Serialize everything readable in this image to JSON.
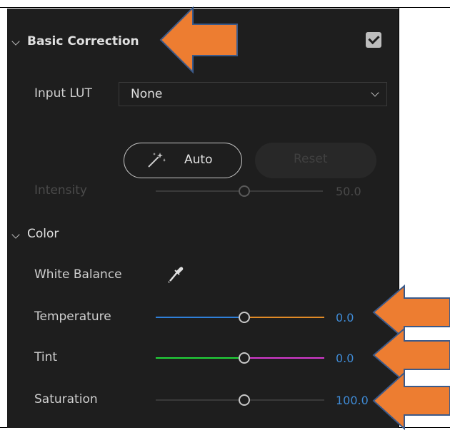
{
  "section_basic": {
    "title": "Basic Correction",
    "enabled": true
  },
  "input_lut": {
    "label": "Input LUT",
    "value": "None"
  },
  "buttons": {
    "auto": "Auto",
    "reset": "Reset"
  },
  "intensity": {
    "label": "Intensity",
    "value": "50.0"
  },
  "section_color": {
    "title": "Color"
  },
  "white_balance": {
    "label": "White Balance"
  },
  "temperature": {
    "label": "Temperature",
    "value": "0.0"
  },
  "tint": {
    "label": "Tint",
    "value": "0.0"
  },
  "saturation": {
    "label": "Saturation",
    "value": "100.0"
  },
  "colors": {
    "panel_bg": "#1e1e1e",
    "value_blue": "#3f8bd6",
    "annotation_orange": "#ed7d31",
    "annotation_outline": "#3b5a8a"
  }
}
